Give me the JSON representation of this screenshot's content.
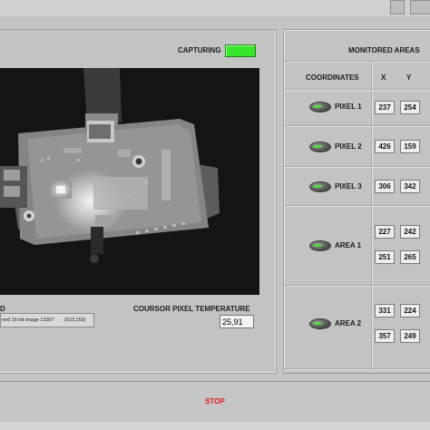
{
  "status": {
    "label": "CAPTURING",
    "led_color": "#39e52a"
  },
  "monitored": {
    "title": "MONITORED AREAS",
    "col_coordinates": "COORDINATES",
    "col_x": "X",
    "col_y": "Y"
  },
  "rows": [
    {
      "label": "PIXEL 1",
      "x": "237",
      "y": "254"
    },
    {
      "label": "PIXEL 2",
      "x": "426",
      "y": "159"
    },
    {
      "label": "PIXEL 3",
      "x": "306",
      "y": "342"
    },
    {
      "label": "AREA 1",
      "x1": "227",
      "y1": "242",
      "x2": "251",
      "y2": "265"
    },
    {
      "label": "AREA 2",
      "x1": "331",
      "y1": "224",
      "x2": "357",
      "y2": "249"
    }
  ],
  "left_label_partial": "D",
  "image_info": {
    "text": "ned 16-bit image 13307",
    "coords": "(623,153)"
  },
  "cursor_temp": {
    "label": "COURSOR PIXEL TEMPERATURE",
    "value": "25,91"
  },
  "stop_button": {
    "label": "STOP",
    "color": "#e01b1b"
  }
}
